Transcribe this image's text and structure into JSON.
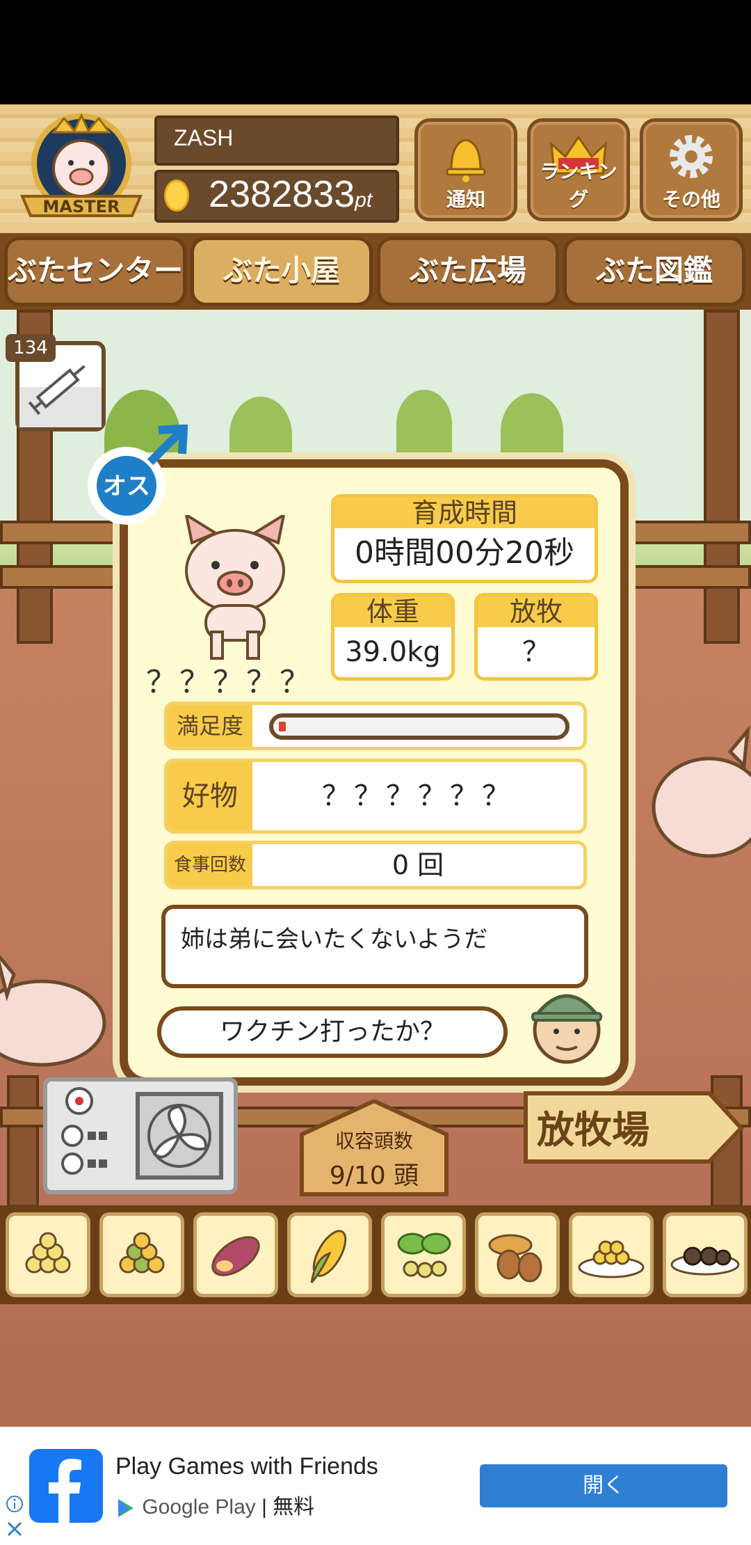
{
  "header": {
    "player_name": "ZASH",
    "points": "2382833",
    "points_unit": "pt",
    "badge_label": "MASTER",
    "buttons": [
      {
        "label": "通知",
        "icon": "bell-icon"
      },
      {
        "label": "ランキング",
        "icon": "crown-icon"
      },
      {
        "label": "その他",
        "icon": "gear-icon"
      }
    ]
  },
  "tabs": [
    {
      "label": "ぶたセンター",
      "active": false
    },
    {
      "label": "ぶた小屋",
      "active": true
    },
    {
      "label": "ぶた広場",
      "active": false
    },
    {
      "label": "ぶた図鑑",
      "active": false
    }
  ],
  "vaccine": {
    "count": "134",
    "icon": "syringe-icon"
  },
  "pig_panel": {
    "sex_label": "オス",
    "pig_name": "？？？？？",
    "growth_time": {
      "label": "育成時間",
      "value": "0時間00分20秒"
    },
    "weight": {
      "label": "体重",
      "value": "39.0kg"
    },
    "grazing": {
      "label": "放牧",
      "value": "？"
    },
    "satisfaction": {
      "label": "満足度",
      "level": 0.02
    },
    "favorite": {
      "label": "好物",
      "value": "？？？？？？"
    },
    "meals": {
      "label": "食事回数",
      "value": "0 回"
    },
    "message": "姉は弟に会いたくないようだ",
    "farmer_hint": "ワクチン打ったか？"
  },
  "capacity": {
    "label": "収容頭数",
    "value": "9/10 頭"
  },
  "pasture_button": "放牧場",
  "foods": [
    "feed-icon",
    "mixed-feed-icon",
    "sweet-potato-icon",
    "corn-icon",
    "greens-icon",
    "acorn-icon",
    "grain-plate-icon",
    "truffle-plate-icon"
  ],
  "ad": {
    "title": "Play Games with Friends",
    "store": "Google Play",
    "price": "| 無料",
    "open_label": "開く"
  },
  "colors": {
    "wood": "#7a4a1c",
    "panel": "#fffbd2",
    "accent": "#f8cb4a",
    "ad_button": "#2f7fd4"
  }
}
